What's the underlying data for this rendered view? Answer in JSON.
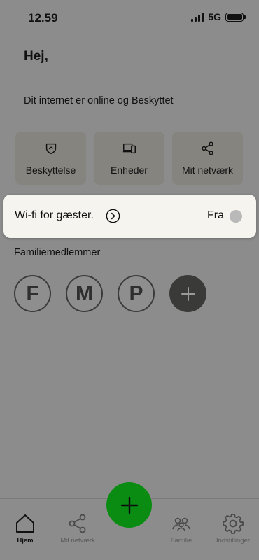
{
  "status_bar": {
    "time": "12.59",
    "network": "5G"
  },
  "greeting": "Hej,",
  "status_message": "Dit internet er online og Beskyttet",
  "tiles": [
    {
      "label": "Beskyttelse",
      "icon": "shield-icon"
    },
    {
      "label": "Enheder",
      "icon": "devices-icon"
    },
    {
      "label": "Mit netværk",
      "icon": "share-network-icon"
    }
  ],
  "wifi_guest": {
    "label": "Wi-fi for gæster.",
    "state": "Fra",
    "enabled": false
  },
  "family": {
    "title": "Familiemedlemmer",
    "members": [
      "F",
      "M",
      "P"
    ]
  },
  "tab_bar": {
    "items": [
      {
        "label": "Hjem",
        "icon": "home-icon",
        "active": true
      },
      {
        "label": "Mit netværk",
        "icon": "share-network-icon",
        "active": false
      },
      {
        "label": "Familie",
        "icon": "family-icon",
        "active": false
      },
      {
        "label": "Indstillinger",
        "icon": "gear-icon",
        "active": false
      }
    ]
  },
  "colors": {
    "background": "#8c8c8c",
    "card": "#f6f4ee",
    "fab": "#0a8c13",
    "add_member": "#3a3a38"
  }
}
